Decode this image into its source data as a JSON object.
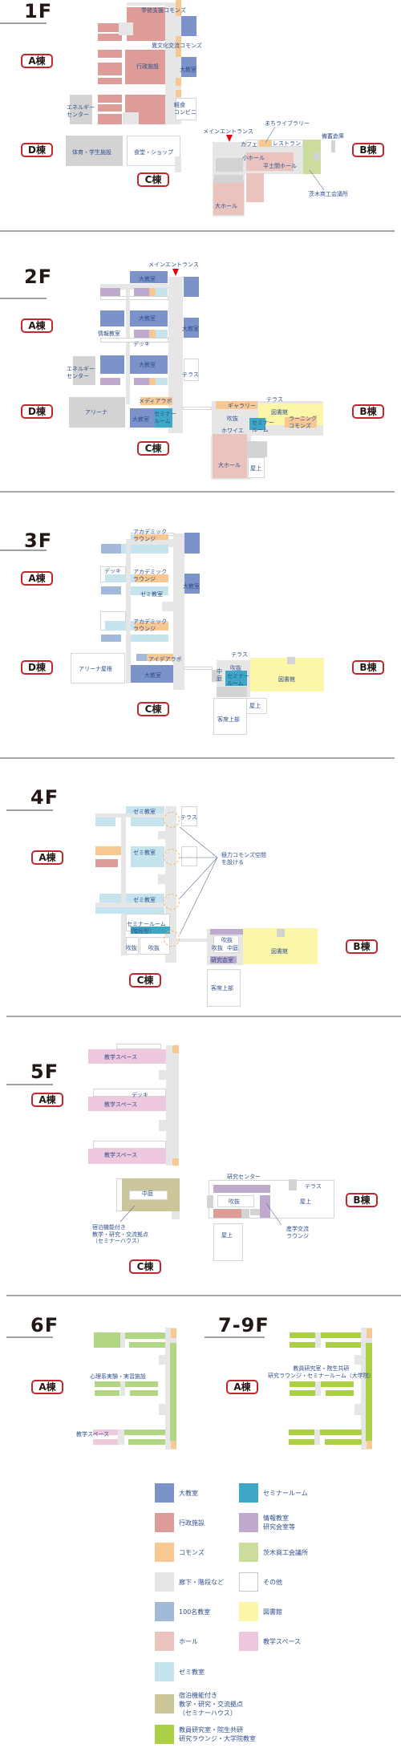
{
  "buildings": {
    "A": "A棟",
    "B": "B棟",
    "C": "C棟",
    "D": "D棟"
  },
  "floors": [
    {
      "title": "1F",
      "labels": [
        "学修支援コモンズ",
        "異文化交流コモンズ",
        "行政施設",
        "大教室",
        "エネルギー\nセンター",
        "軽食\nコンビニ",
        "まちライブラリー",
        "メインエントランス",
        "備蓄倉庫",
        "カフェ",
        "レストラン",
        "体育・学生施設",
        "食堂・ショップ",
        "小ホール",
        "平土間ホール",
        "茨木商工会議所",
        "大ホール"
      ]
    },
    {
      "title": "2F",
      "labels": [
        "メインエントランス",
        "大教室",
        "大教室",
        "情報教室",
        "大教室",
        "デッキ",
        "大教室",
        "エネルギー\nセンター",
        "テラス",
        "メディアラボ",
        "アリーナ",
        "大教室",
        "セミナー\nルーム",
        "テラス",
        "ギャラリー",
        "図書館",
        "吹抜",
        "セミナー\nルーム",
        "ラーニング\nコモンズ",
        "ホワイエ",
        "大ホール",
        "屋上"
      ]
    },
    {
      "title": "3F",
      "labels": [
        "アカデミック\nラウンジ",
        "デッキ",
        "アカデミック\nラウンジ",
        "大教室",
        "ゼミ教室",
        "アカデミック\nラウンジ",
        "アイデアラボ",
        "テラス",
        "アリーナ屋根",
        "中\n庭",
        "吹抜",
        "セミナー\nルーム",
        "大教室",
        "図書館",
        "屋上",
        "客席上部"
      ]
    },
    {
      "title": "4F",
      "labels": [
        "ゼミ教室",
        "テラス",
        "ゼミ教室",
        "極力コモンズ空間\nを設ける",
        "ゼミ教室",
        "セミナールーム\n（階段型）",
        "吹抜",
        "吹抜",
        "吹抜",
        "吹抜",
        "中庭",
        "図書館",
        "研究会室",
        "客席上部"
      ]
    },
    {
      "title": "5F",
      "labels": [
        "教学スペース",
        "デッキ",
        "教学スペース",
        "教学スペース",
        "中庭",
        "宿泊機能付き\n教学・研究・交流拠点\n（セミナーハウス）",
        "研究センター",
        "テラス",
        "吹抜",
        "屋上",
        "産学交流\nラウンジ",
        "屋上"
      ]
    },
    {
      "title": "6F",
      "labels": [
        "心理系実験・実習施設",
        "教学スペース"
      ]
    },
    {
      "title": "7-9F",
      "labels": [
        "教員研究室・院生共研\n研究ラウンジ・セミナールーム（大学院）"
      ]
    }
  ],
  "legend": [
    {
      "label": "大教室",
      "color": "#7b93c9"
    },
    {
      "label": "セミナールーム",
      "color": "#3fa7c6"
    },
    {
      "label": "行政施設",
      "color": "#dd9c97"
    },
    {
      "label": "情報教室\n研究会室等",
      "color": "#bfa9cc"
    },
    {
      "label": "コモンズ",
      "color": "#f7c892"
    },
    {
      "label": "茨木商工会議所",
      "color": "#cbdc9d"
    },
    {
      "label": "廊下・階段など",
      "color": "#e6e6e6"
    },
    {
      "label": "その他",
      "color": "#ffffff"
    },
    {
      "label": "100名教室",
      "color": "#a3b9d9"
    },
    {
      "label": "図書館",
      "color": "#fbf6a8"
    },
    {
      "label": "ホール",
      "color": "#eac3be"
    },
    {
      "label": "教学スペース",
      "color": "#eec8dd"
    },
    {
      "label": "ゼミ教室",
      "color": "#c5e4ee"
    },
    {
      "label": "宿泊機能付き\n教学・研究・交流拠点\n（セミナーハウス）",
      "color": "#cbc59a"
    },
    {
      "label": "教員研究室・院生共研\n研究ラウンジ・大学院教室",
      "color": "#acd045"
    }
  ],
  "entrance_marker_color": "#e60012",
  "building_label_border_color": "#c0282d"
}
